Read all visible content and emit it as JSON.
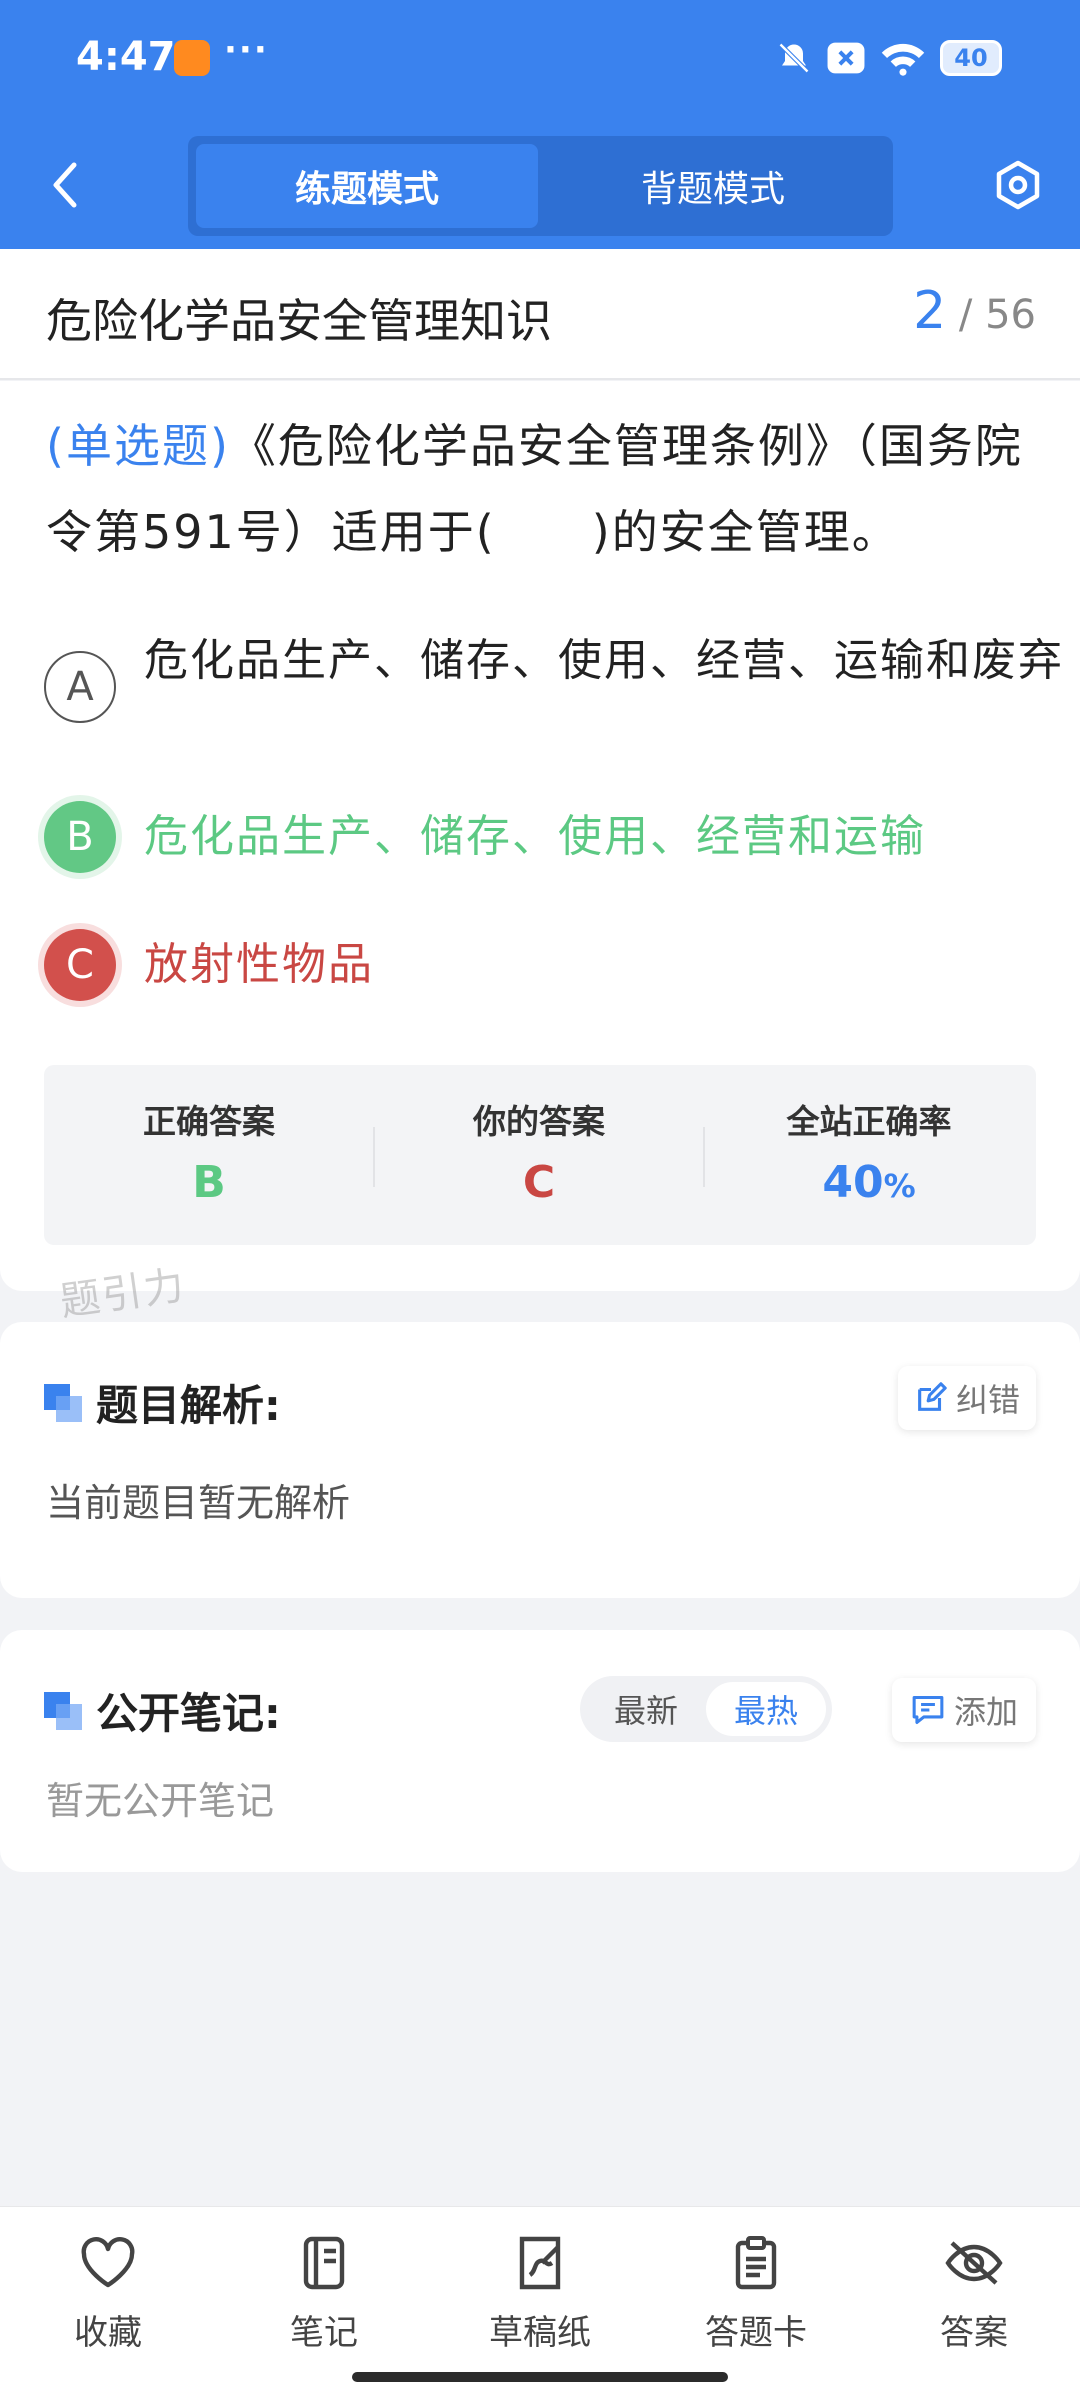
{
  "status_bar": {
    "time": "4:47",
    "dots": "···",
    "battery": "40"
  },
  "nav": {
    "tab_practice": "练题模式",
    "tab_memorize": "背题模式"
  },
  "header": {
    "title": "危险化学品安全管理知识",
    "current": "2",
    "separator": " / ",
    "total": "56"
  },
  "question": {
    "type_label": "(单选题)",
    "text": "《危险化学品安全管理条例》（国务院令第591号）适用于(　　)的安全管理。",
    "options": [
      {
        "letter": "A",
        "text": "危化品生产、储存、使用、经营、运输和废弃",
        "state": "normal"
      },
      {
        "letter": "B",
        "text": "危化品生产、储存、使用、经营和运输",
        "state": "correct"
      },
      {
        "letter": "C",
        "text": "放射性物品",
        "state": "wrong"
      }
    ]
  },
  "stats": {
    "correct_label": "正确答案",
    "correct_value": "B",
    "yours_label": "你的答案",
    "yours_value": "C",
    "rate_label": "全站正确率",
    "rate_value": "40",
    "rate_unit": "%"
  },
  "watermark": "题引力",
  "analysis": {
    "title": "题目解析:",
    "correct_button": "纠错",
    "body": "当前题目暂无解析"
  },
  "notes": {
    "title": "公开笔记:",
    "sort_newest": "最新",
    "sort_hottest": "最热",
    "add_button": "添加",
    "body": "暂无公开笔记"
  },
  "bottom_bar": {
    "favorite": "收藏",
    "notes": "笔记",
    "scratch": "草稿纸",
    "answer_card": "答题卡",
    "answer": "答案"
  },
  "colors": {
    "primary": "#3a82ee",
    "correct": "#5cc983",
    "wrong": "#c94743"
  }
}
